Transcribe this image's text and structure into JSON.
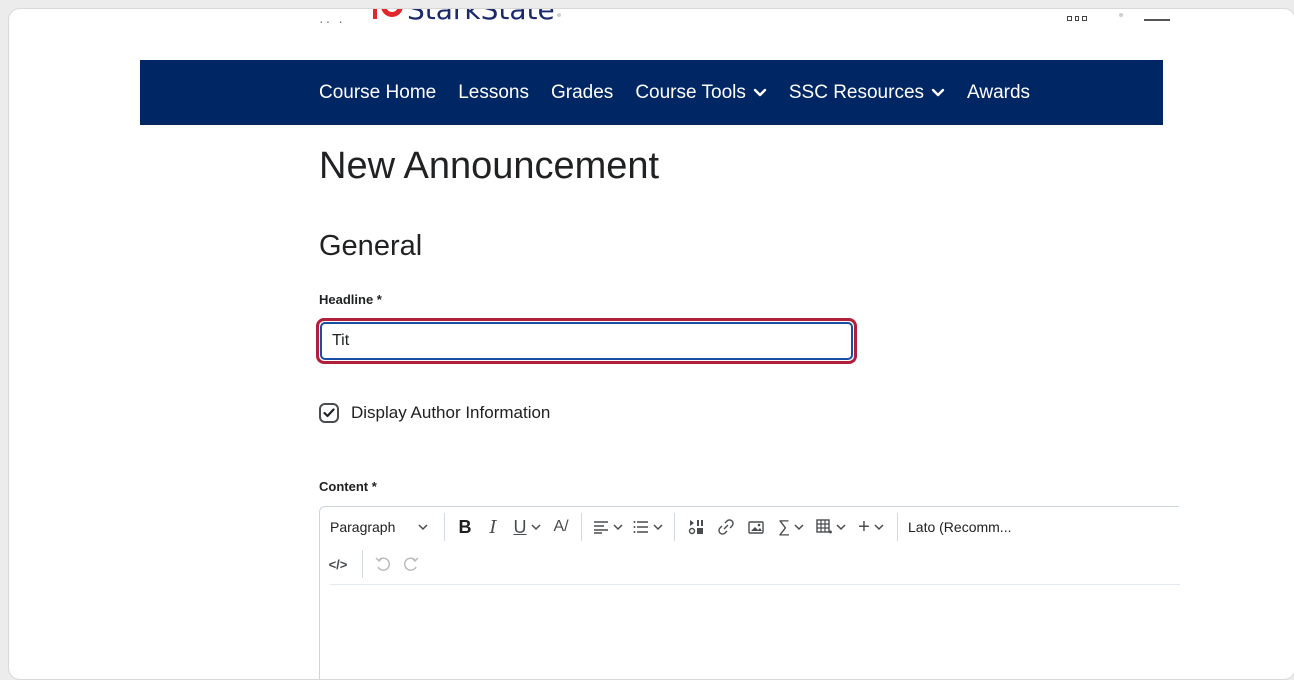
{
  "header": {
    "logo_text": "StarkState"
  },
  "nav": {
    "items": [
      {
        "label": "Course Home",
        "has_dropdown": false
      },
      {
        "label": "Lessons",
        "has_dropdown": false
      },
      {
        "label": "Grades",
        "has_dropdown": false
      },
      {
        "label": "Course Tools",
        "has_dropdown": true
      },
      {
        "label": "SSC Resources",
        "has_dropdown": true
      },
      {
        "label": "Awards",
        "has_dropdown": false
      }
    ],
    "background": "#002663"
  },
  "page": {
    "title": "New Announcement",
    "section_title": "General"
  },
  "form": {
    "headline_label": "Headline *",
    "headline_value": "Tit",
    "display_author_label": "Display Author Information",
    "display_author_checked": true,
    "content_label": "Content *"
  },
  "editor": {
    "block_format": "Paragraph",
    "font_family": "Lato (Recomm...",
    "toolbar_icons": [
      "bold-icon",
      "italic-icon",
      "underline-icon",
      "text-color-icon",
      "align-icon",
      "list-icon",
      "insert-stuff-icon",
      "link-icon",
      "image-icon",
      "equation-icon",
      "table-icon",
      "more-insert-icon",
      "source-code-icon",
      "undo-icon",
      "redo-icon"
    ]
  },
  "colors": {
    "focus_ring": "#b0203b",
    "input_border": "#1a4ea3"
  }
}
